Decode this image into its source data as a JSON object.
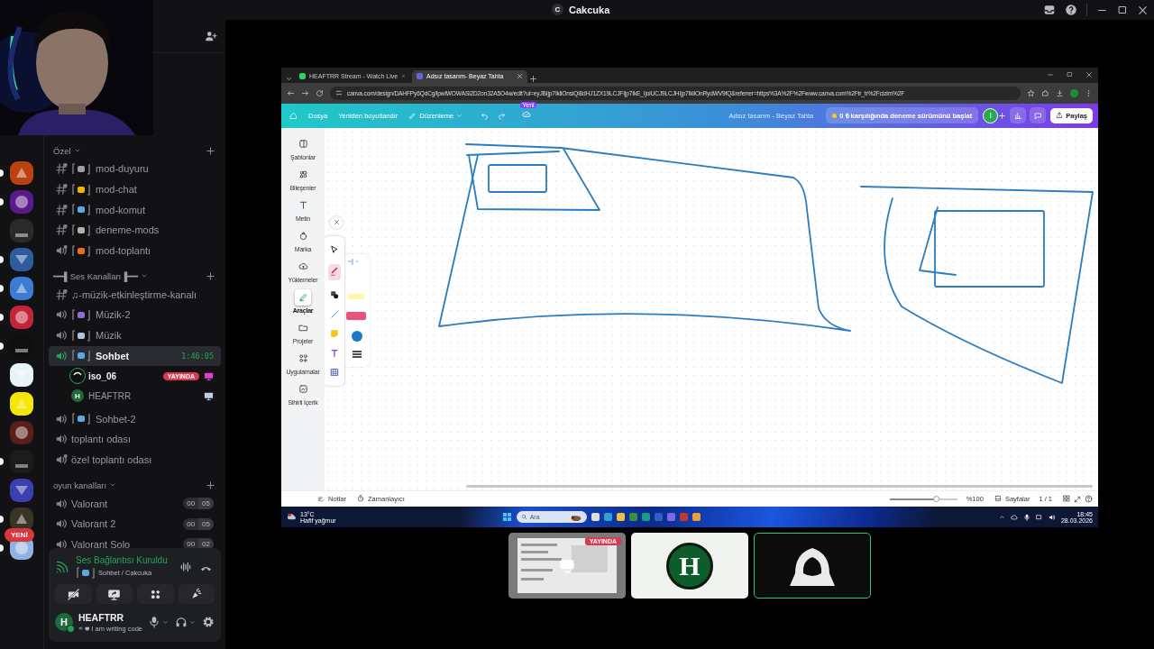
{
  "window": {
    "title": "Cakcuka",
    "server_initial": "C"
  },
  "servers": [
    {
      "color": "#b8430f",
      "unread": true
    },
    {
      "color": "#5b1a8c",
      "unread": true
    },
    {
      "color": "#2a2a2a",
      "unread": false
    },
    {
      "color": "#2f5b9e",
      "unread": true
    },
    {
      "color": "#3c7bd1",
      "unread": true
    },
    {
      "color": "#c2243a",
      "unread": true
    },
    {
      "color": "#0f0f0f",
      "unread": true
    },
    {
      "color": "#e8f3f7",
      "unread": false
    },
    {
      "color": "#f5e60a",
      "unread": false
    },
    {
      "color": "#5a1f1a",
      "unread": false
    },
    {
      "color": "#1c1c1c",
      "unread": true
    },
    {
      "color": "#3b3fb0",
      "unread": false
    },
    {
      "color": "#3a3426",
      "unread": true
    },
    {
      "color": "#8fb3e0",
      "unread": true
    }
  ],
  "new_badge": "YENİ",
  "channel_groups": [
    {
      "name": "Özel",
      "expanded": true,
      "channels": [
        {
          "kind": "text",
          "private": true,
          "tagged": true,
          "selected": false,
          "name": "mod-duyuru"
        },
        {
          "kind": "text",
          "private": true,
          "tagged": true,
          "selected": false,
          "name": "mod-chat"
        },
        {
          "kind": "text",
          "private": true,
          "tagged": true,
          "selected": false,
          "name": "mod-komut"
        },
        {
          "kind": "text",
          "private": true,
          "tagged": true,
          "selected": false,
          "name": "deneme-mods"
        },
        {
          "kind": "voice",
          "private": true,
          "tagged": true,
          "selected": false,
          "name": "mod-toplantı"
        }
      ]
    },
    {
      "name": "━━▌Ses Kanalları▐━━",
      "expanded": true,
      "channels": [
        {
          "kind": "text",
          "private": true,
          "tagged": false,
          "selected": false,
          "name": "♫-müzik-etkinleştirme-kanalı"
        },
        {
          "kind": "voice",
          "private": false,
          "tagged": true,
          "selected": false,
          "name": "Müzik-2"
        },
        {
          "kind": "voice",
          "private": false,
          "tagged": true,
          "selected": false,
          "name": "Müzik"
        },
        {
          "kind": "voice",
          "private": false,
          "tagged": true,
          "selected": true,
          "name": "Sohbet",
          "timer": "1:46:05",
          "members": [
            {
              "name": "iso_06",
              "speaking": true,
              "live_badge": "YAYINDA",
              "screen_icon": false
            },
            {
              "name": "HEAFTRR",
              "initial": "H",
              "speaking": false,
              "screen_icon": true
            }
          ]
        },
        {
          "kind": "voice",
          "private": false,
          "tagged": true,
          "selected": false,
          "name": "Sohbet-2"
        },
        {
          "kind": "voice",
          "private": false,
          "tagged": false,
          "selected": false,
          "name": "toplantı odası"
        },
        {
          "kind": "voice",
          "private": true,
          "tagged": false,
          "selected": false,
          "name": "özel toplantı odası"
        }
      ]
    },
    {
      "name": "oyun kanalları",
      "expanded": true,
      "channels": [
        {
          "kind": "voice",
          "private": false,
          "tagged": false,
          "selected": false,
          "name": "Valorant",
          "counts": [
            "00",
            "05"
          ]
        },
        {
          "kind": "voice",
          "private": false,
          "tagged": false,
          "selected": false,
          "name": "Valorant 2",
          "counts": [
            "00",
            "05"
          ]
        },
        {
          "kind": "voice",
          "private": false,
          "tagged": false,
          "selected": false,
          "name": "Valorant Solo",
          "counts": [
            "00",
            "02"
          ]
        }
      ]
    }
  ],
  "voice_panel": {
    "status": "Ses Bağlantısı Kuruldu",
    "channel": "Sohbet / Cakcuka"
  },
  "user": {
    "name": "HEAFTRR",
    "initial": "H",
    "activity": "I am writing code"
  },
  "stream": {
    "tabs": [
      {
        "label": "HEAFTRR Stream - Watch Live",
        "selected": false
      },
      {
        "label": "Adsız tasarım- Beyaz Tahta",
        "selected": true
      }
    ],
    "url": "canva.com/design/DAHFPy6QdCg/lpwlWOWASi2D2on32A5O4w/edit?ui=eyJBIjp7IkliOnsiQi8dHJ1ZX19LCJFIjp7IkE_IjoiUCJ9LCJHIjp7IkliOnRydWV9fQ&referrer=https%3A%2F%2Fwww.canva.com%2Ftr_tr%2Fcizim%2F",
    "menu": [
      "Dosya",
      "Yeniden boyutlandır",
      "Düzenleme"
    ],
    "new_tag": "Yeni",
    "doc_title": "Adsız tasarım - Beyaz Tahta",
    "trial": "0 ₺ karşılığında deneme sürümünü başlat",
    "avatar": "I",
    "share": "Paylaş",
    "side": [
      {
        "label": "Şablonlar",
        "selected": false
      },
      {
        "label": "Bileşenler",
        "selected": false
      },
      {
        "label": "Metin",
        "selected": false
      },
      {
        "label": "Marka",
        "selected": false
      },
      {
        "label": "Yüklemeler",
        "selected": false
      },
      {
        "label": "Araçlar",
        "selected": true
      },
      {
        "label": "Projeler",
        "selected": false
      },
      {
        "label": "Uygulamalar",
        "selected": false
      },
      {
        "label": "Sihirli İçerik",
        "selected": false
      }
    ],
    "footer": {
      "notes": "Notlar",
      "timer": "Zamanlayıcı",
      "zoom": {
        "level": 0.68
      },
      "zoom_text": "%100",
      "pages": "Sayfalar",
      "page_count": "1 / 1"
    },
    "taskbar": {
      "temp": "13°C",
      "weather": "Hafif yağmur",
      "search": "Ara",
      "time": "18:45",
      "date": "28.03.2026"
    }
  },
  "tiles": [
    {
      "kind": "stream",
      "badge": "YAYINDA",
      "selected": false
    },
    {
      "kind": "avatar",
      "initial": "H",
      "selected": false
    },
    {
      "kind": "hood",
      "selected": true
    }
  ]
}
